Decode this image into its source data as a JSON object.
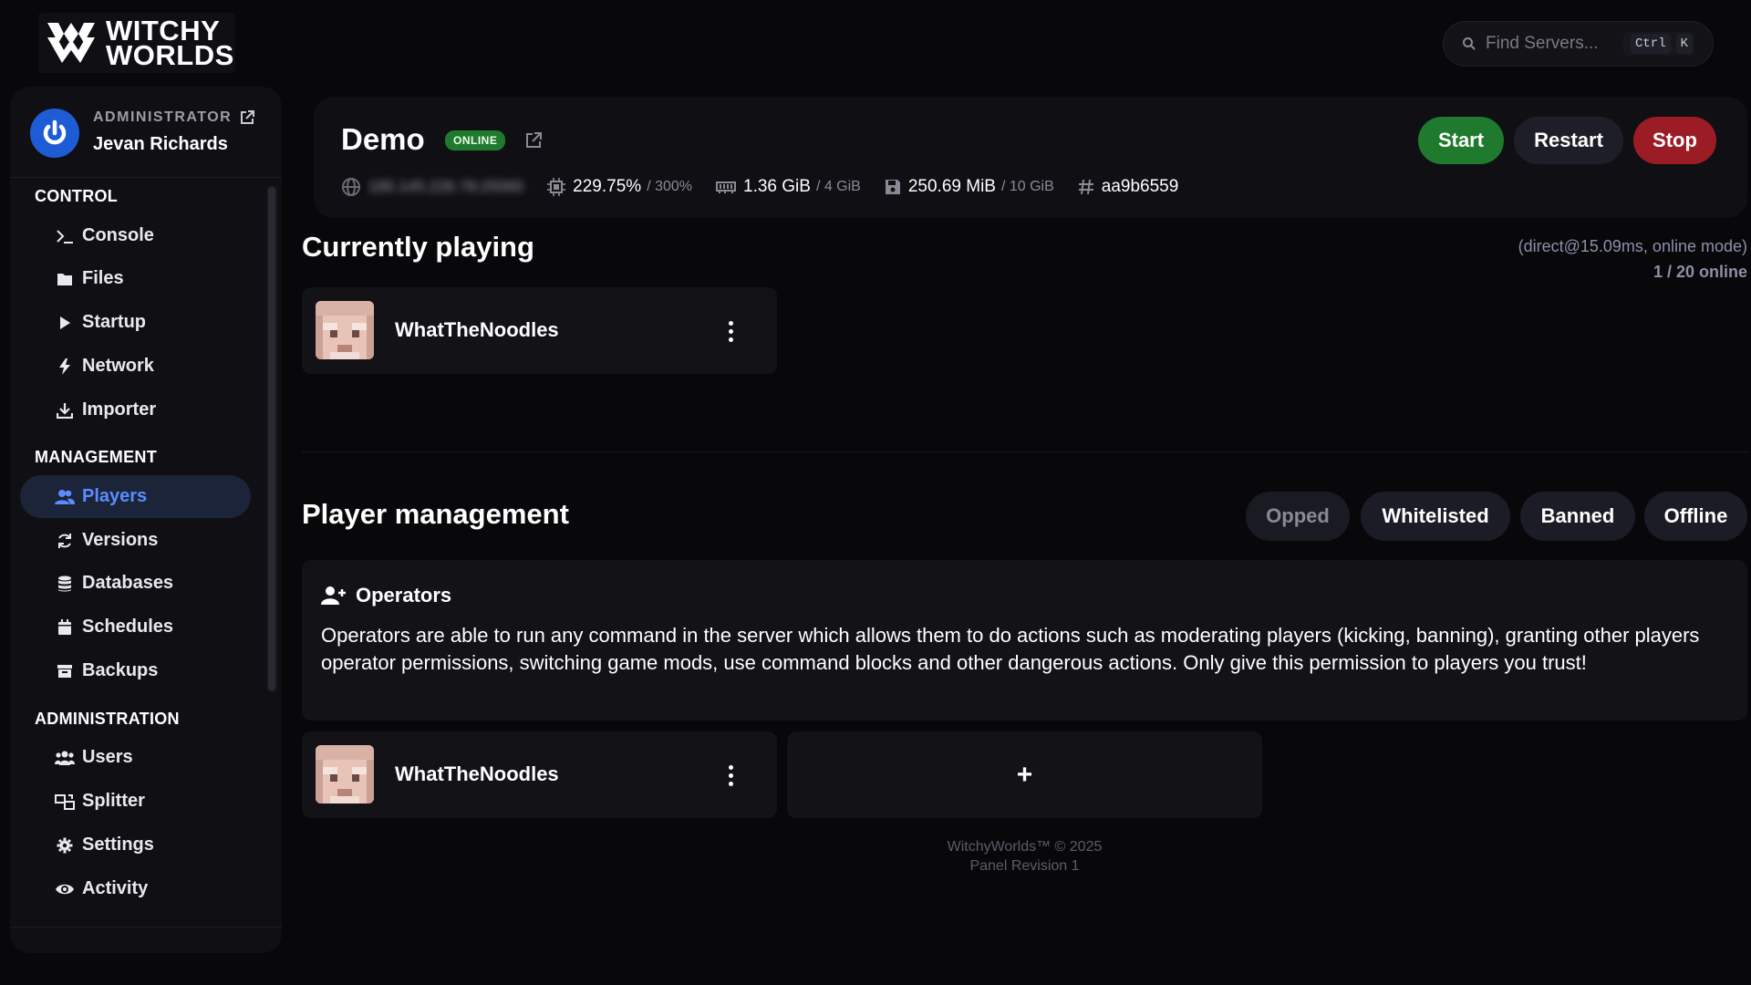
{
  "brand": {
    "line1": "WITCHY",
    "line2": "WORLDS"
  },
  "search": {
    "placeholder": "Find Servers...",
    "shortcut_mod": "Ctrl",
    "shortcut_key": "K"
  },
  "user": {
    "role": "ADMINISTRATOR",
    "name": "Jevan Richards"
  },
  "sidebar": {
    "sections": [
      {
        "title": "CONTROL",
        "items": [
          {
            "label": "Console",
            "icon": "terminal-icon"
          },
          {
            "label": "Files",
            "icon": "folder-icon"
          },
          {
            "label": "Startup",
            "icon": "play-icon"
          },
          {
            "label": "Network",
            "icon": "bolt-icon"
          },
          {
            "label": "Importer",
            "icon": "download-icon"
          }
        ]
      },
      {
        "title": "MANAGEMENT",
        "items": [
          {
            "label": "Players",
            "icon": "users-icon",
            "active": true
          },
          {
            "label": "Versions",
            "icon": "refresh-icon"
          },
          {
            "label": "Databases",
            "icon": "database-icon"
          },
          {
            "label": "Schedules",
            "icon": "calendar-icon"
          },
          {
            "label": "Backups",
            "icon": "archive-icon"
          }
        ]
      },
      {
        "title": "ADMINISTRATION",
        "items": [
          {
            "label": "Users",
            "icon": "user-group-icon"
          },
          {
            "label": "Splitter",
            "icon": "splitter-icon"
          },
          {
            "label": "Settings",
            "icon": "gear-icon"
          },
          {
            "label": "Activity",
            "icon": "eye-icon"
          }
        ]
      }
    ]
  },
  "server": {
    "name": "Demo",
    "status": "ONLINE",
    "address": "185.145.226.78:25565",
    "cpu": "229.75%",
    "cpu_limit": "/ 300%",
    "memory": "1.36 GiB",
    "memory_limit": "/ 4 GiB",
    "disk": "250.69 MiB",
    "disk_limit": "/ 10 GiB",
    "id": "aa9b6559",
    "buttons": {
      "start": "Start",
      "restart": "Restart",
      "stop": "Stop"
    }
  },
  "colors": {
    "accent": "#5b8cff",
    "online": "#1f7a2e",
    "danger": "#9c1c26"
  },
  "playing": {
    "title": "Currently playing",
    "connection": "(direct@15.09ms, online mode)",
    "count": "1 / 20 online",
    "players": [
      {
        "name": "WhatTheNoodles"
      }
    ]
  },
  "management": {
    "title": "Player management",
    "filters": [
      "Opped",
      "Whitelisted",
      "Banned",
      "Offline"
    ],
    "active_filter": "Opped",
    "operators": {
      "title": "Operators",
      "description": "Operators are able to run any command in the server which allows them to do actions such as moderating players (kicking, banning), granting other players operator permissions, switching game mods, use command blocks and other dangerous actions. Only give this permission to players you trust!",
      "players": [
        {
          "name": "WhatTheNoodles"
        }
      ],
      "add_label": "+"
    }
  },
  "footer": {
    "line1": "WitchyWorlds™ © 2025",
    "line2": "Panel Revision 1"
  }
}
